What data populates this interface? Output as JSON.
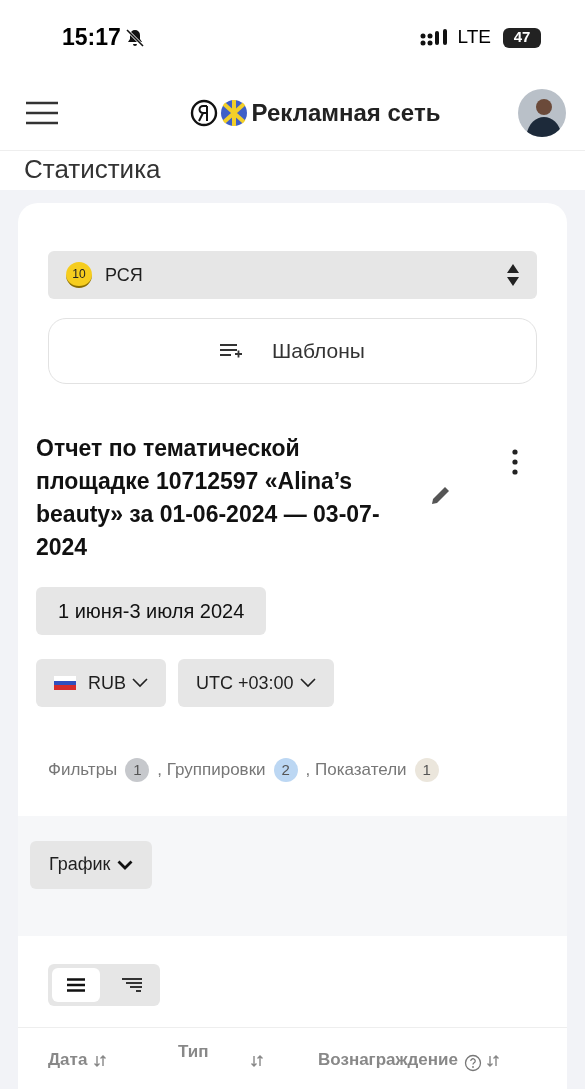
{
  "status_bar": {
    "time": "15:17",
    "network": "LTE",
    "battery": "47"
  },
  "header": {
    "title": "Рекламная сеть"
  },
  "page_title": "Статистика",
  "source_select": {
    "badge": "10",
    "value": "РСЯ"
  },
  "templates_button": "Шаблоны",
  "report_title": "Отчет по тематической площадке 10712597 «Alina’s beauty» за 01-06-2024 — 03-07-2024",
  "date_range": "1 июня-3 июля 2024",
  "currency": "RUB",
  "timezone": "UTC +03:00",
  "settings": [
    {
      "label": "Фильтры",
      "count": "1",
      "color": "#c6c8cc"
    },
    {
      "label": ", Группировки",
      "count": "2",
      "color": "#bcd7f3"
    },
    {
      "label": ", Показатели",
      "count": "1",
      "color": "#ebe6dc"
    }
  ],
  "chart_toggle": "График",
  "view_modes": [
    {
      "kind": "flat",
      "selected": true
    },
    {
      "kind": "tree",
      "selected": false
    }
  ],
  "table": {
    "columns": [
      "Дата",
      "Тип",
      "Вознаграждение"
    ]
  }
}
